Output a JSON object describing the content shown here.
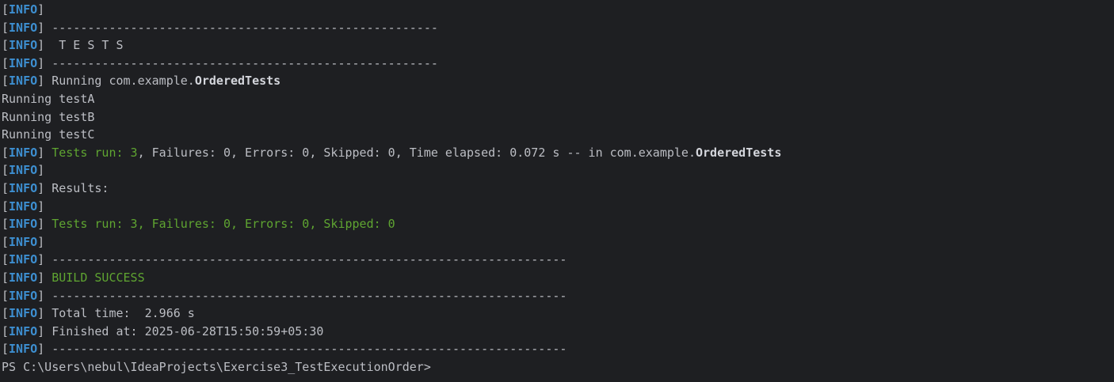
{
  "tag": "INFO",
  "lines": [
    {
      "kind": "info",
      "parts": []
    },
    {
      "kind": "info",
      "parts": [
        {
          "t": "------------------------------------------------------",
          "s": "plain"
        }
      ]
    },
    {
      "kind": "info",
      "parts": [
        {
          "t": " T E S T S",
          "s": "plain"
        }
      ]
    },
    {
      "kind": "info",
      "parts": [
        {
          "t": "------------------------------------------------------",
          "s": "plain"
        }
      ]
    },
    {
      "kind": "info",
      "parts": [
        {
          "t": "Running com.example.",
          "s": "plain"
        },
        {
          "t": "OrderedTests",
          "s": "bold"
        }
      ]
    },
    {
      "kind": "plain",
      "parts": [
        {
          "t": "Running testA",
          "s": "plain"
        }
      ]
    },
    {
      "kind": "plain",
      "parts": [
        {
          "t": "Running testB",
          "s": "plain"
        }
      ]
    },
    {
      "kind": "plain",
      "parts": [
        {
          "t": "Running testC",
          "s": "plain"
        }
      ]
    },
    {
      "kind": "info",
      "parts": [
        {
          "t": "Tests run: 3",
          "s": "green"
        },
        {
          "t": ", Failures: 0, Errors: 0, Skipped: 0, Time elapsed: 0.072 s -- in com.example.",
          "s": "plain"
        },
        {
          "t": "OrderedTests",
          "s": "bold"
        }
      ]
    },
    {
      "kind": "info",
      "parts": []
    },
    {
      "kind": "info",
      "parts": [
        {
          "t": "Results:",
          "s": "plain"
        }
      ]
    },
    {
      "kind": "info",
      "parts": []
    },
    {
      "kind": "info",
      "parts": [
        {
          "t": "Tests run: 3, Failures: 0, Errors: 0, Skipped: 0",
          "s": "green"
        }
      ]
    },
    {
      "kind": "info",
      "parts": []
    },
    {
      "kind": "info",
      "parts": [
        {
          "t": "------------------------------------------------------------------------",
          "s": "plain"
        }
      ]
    },
    {
      "kind": "info",
      "parts": [
        {
          "t": "BUILD SUCCESS",
          "s": "green"
        }
      ]
    },
    {
      "kind": "info",
      "parts": [
        {
          "t": "------------------------------------------------------------------------",
          "s": "plain"
        }
      ]
    },
    {
      "kind": "info",
      "parts": [
        {
          "t": "Total time:  2.966 s",
          "s": "plain"
        }
      ]
    },
    {
      "kind": "info",
      "parts": [
        {
          "t": "Finished at: 2025-06-28T15:50:59+05:30",
          "s": "plain"
        }
      ]
    },
    {
      "kind": "info",
      "parts": [
        {
          "t": "------------------------------------------------------------------------",
          "s": "plain"
        }
      ]
    },
    {
      "kind": "prompt",
      "parts": [
        {
          "t": "PS C:\\Users\\nebul\\IdeaProjects\\Exercise3_TestExecutionOrder>",
          "s": "plain"
        }
      ]
    }
  ],
  "colors": {
    "background": "#1e1f22",
    "text": "#bcbec4",
    "info_tag": "#3d8fd1",
    "success": "#5fa531"
  }
}
